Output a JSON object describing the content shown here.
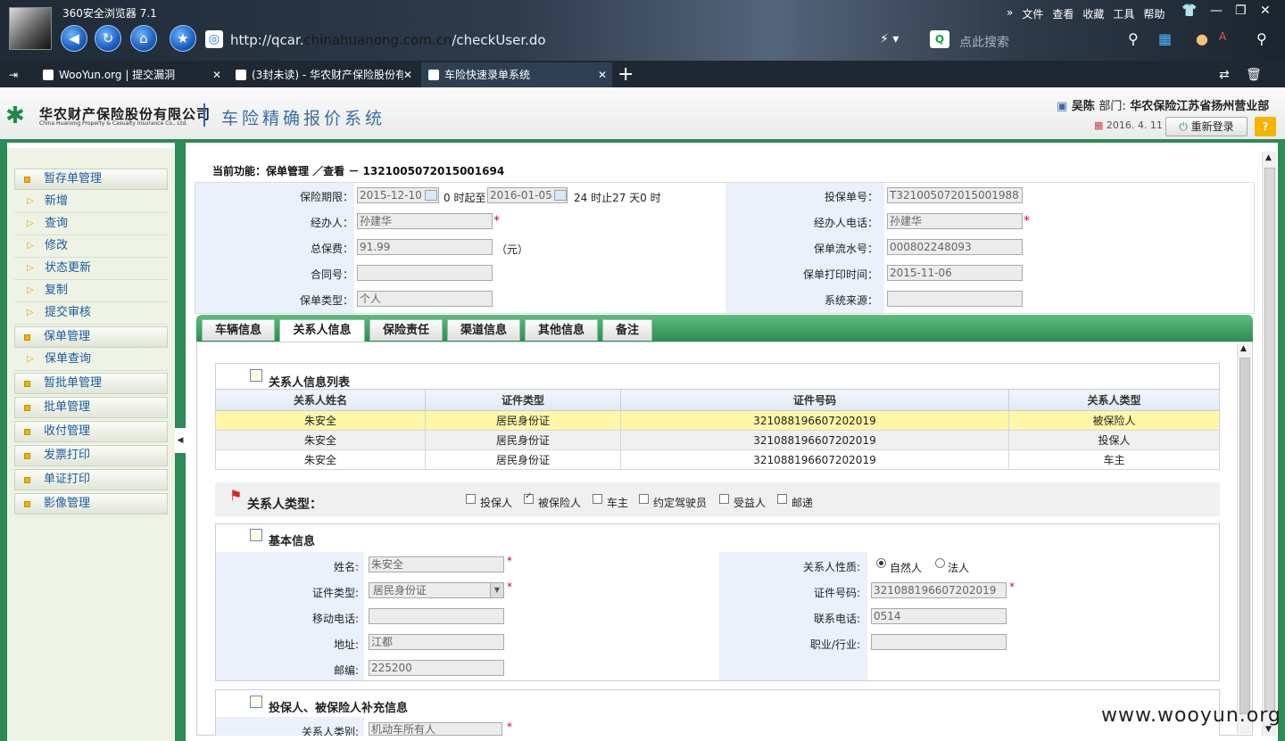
{
  "browser": {
    "app_name": "360安全浏览器 7.1",
    "url_prefix": "http://qcar.",
    "url_domain": "chinahuanong.com.cn",
    "url_path": "/checkUser.do",
    "search_placeholder": "点此搜索",
    "menu": [
      "文件",
      "查看",
      "收藏",
      "工具",
      "帮助"
    ],
    "tabs": [
      {
        "label": "WooYun.org | 提交漏洞",
        "active": false
      },
      {
        "label": "(3封未读) - 华农财产保险股份有",
        "active": false
      },
      {
        "label": "车险快速录单系统",
        "active": true
      }
    ]
  },
  "header": {
    "company_cn": "华农财产保险股份有限公司",
    "company_en": "China Huanong Property & Casualty Insurance Co., Ltd.",
    "system_title": "车险精确报价系统",
    "user": "吴陈",
    "dept_label": "部门:",
    "dept": "华农保险江苏省扬州营业部",
    "date": "2016. 4. 11",
    "relogin": "重新登录",
    "help": "?"
  },
  "sidebar": {
    "items": [
      {
        "label": "暂存单管理",
        "type": "group"
      },
      {
        "label": "新增",
        "type": "sub"
      },
      {
        "label": "查询",
        "type": "sub"
      },
      {
        "label": "修改",
        "type": "sub"
      },
      {
        "label": "状态更新",
        "type": "sub"
      },
      {
        "label": "复制",
        "type": "sub"
      },
      {
        "label": "提交审核",
        "type": "sub"
      },
      {
        "label": "保单管理",
        "type": "group"
      },
      {
        "label": "保单查询",
        "type": "sub"
      },
      {
        "label": "暂批单管理",
        "type": "group"
      },
      {
        "label": "批单管理",
        "type": "group"
      },
      {
        "label": "收付管理",
        "type": "group"
      },
      {
        "label": "发票打印",
        "type": "group"
      },
      {
        "label": "单证打印",
        "type": "group"
      },
      {
        "label": "影像管理",
        "type": "group"
      }
    ]
  },
  "current_function": "当前功能：保单管理 ／查看 － 1321005072015001694",
  "policy": {
    "period_label": "保险期限：",
    "start_date": "2015-12-10",
    "start_suffix": "0 时起至",
    "end_date": "2016-01-05",
    "end_suffix": "24 时止27 天0 时",
    "applicant_no_label": "投保单号：",
    "applicant_no": "T321005072015001988",
    "agent_label": "经办人：",
    "agent": "孙建华",
    "agent_phone_label": "经办人电话：",
    "agent_phone": "孙建华",
    "premium_label": "总保费：",
    "premium": "91.99",
    "premium_unit": "（元）",
    "serial_label": "保单流水号：",
    "serial": "000802248093",
    "contract_label": "合同号：",
    "contract": "",
    "print_time_label": "保单打印时间：",
    "print_time": "2015-11-06",
    "policy_type_label": "保单类型：",
    "policy_type": "个人",
    "source_label": "系统来源：",
    "source": ""
  },
  "page_tabs": [
    "车辆信息",
    "关系人信息",
    "保险责任",
    "渠道信息",
    "其他信息",
    "备注"
  ],
  "relations": {
    "title": "关系人信息列表",
    "columns": [
      "关系人姓名",
      "证件类型",
      "证件号码",
      "关系人类型"
    ],
    "rows": [
      [
        "朱安全",
        "居民身份证",
        "321088196607202019",
        "被保险人"
      ],
      [
        "朱安全",
        "居民身份证",
        "321088196607202019",
        "投保人"
      ],
      [
        "朱安全",
        "居民身份证",
        "321088196607202019",
        "车主"
      ]
    ]
  },
  "relation_types": {
    "label": "关系人类型：",
    "options": [
      {
        "label": "投保人",
        "checked": false
      },
      {
        "label": "被保险人",
        "checked": true
      },
      {
        "label": "车主",
        "checked": false
      },
      {
        "label": "约定驾驶员",
        "checked": false
      },
      {
        "label": "受益人",
        "checked": false
      },
      {
        "label": "邮递",
        "checked": false
      }
    ]
  },
  "basic_info": {
    "title": "基本信息",
    "name_label": "姓名:",
    "name": "朱安全",
    "nature_label": "关系人性质:",
    "nature_natural": "自然人",
    "nature_legal": "法人",
    "id_type_label": "证件类型:",
    "id_type": "居民身份证",
    "id_no_label": "证件号码:",
    "id_no": "321088196607202019",
    "mobile_label": "移动电话:",
    "mobile": "",
    "phone_label": "联系电话:",
    "phone": "0514",
    "address_label": "地址:",
    "address": "江都",
    "job_label": "职业/行业:",
    "job": "",
    "zip_label": "邮编:",
    "zip": "225200"
  },
  "supplement": {
    "title": "投保人、被保险人补充信息",
    "rel_category_label": "关系人类别:",
    "rel_category": "机动车所有人"
  },
  "watermark": "www.wooyun.org"
}
